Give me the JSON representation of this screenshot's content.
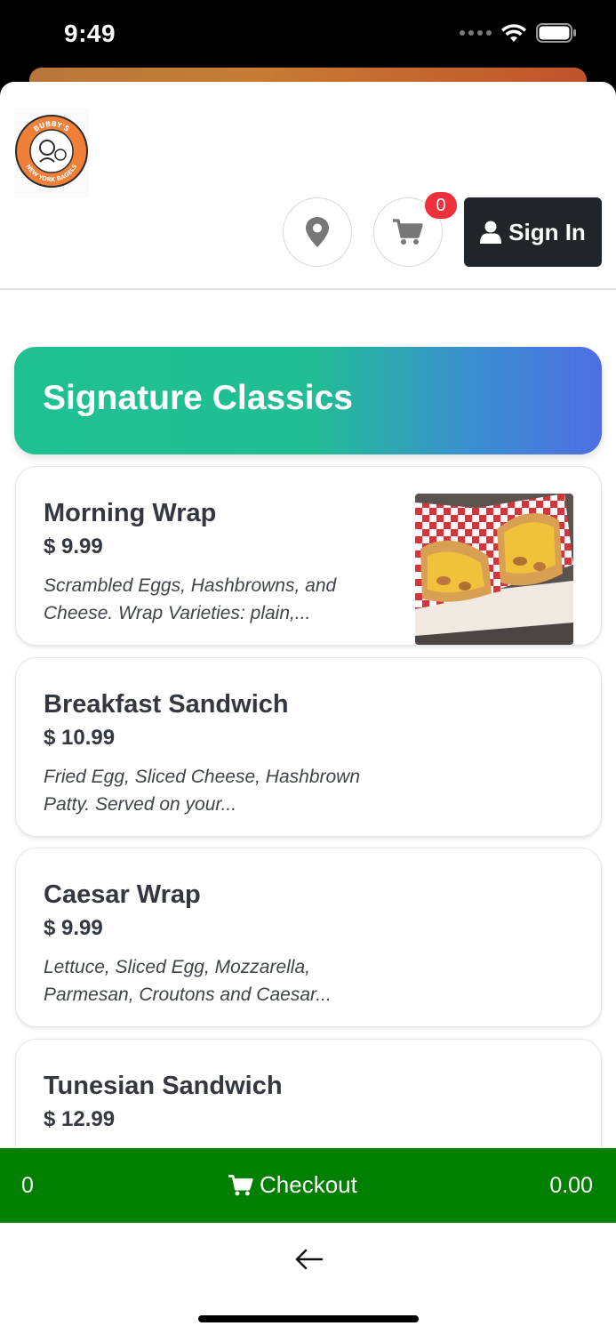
{
  "status_bar": {
    "time": "9:49"
  },
  "header": {
    "logo_top_text": "BUBBY'S",
    "logo_bottom_text": "NEW YORK BAGELS",
    "cart_badge": "0",
    "sign_in_label": "Sign In"
  },
  "category": {
    "title": "Signature Classics"
  },
  "items": [
    {
      "name": "Morning Wrap",
      "price": "$ 9.99",
      "description": "Scrambled Eggs, Hashbrowns, and Cheese. Wrap Varieties: plain,..."
    },
    {
      "name": "Breakfast Sandwich",
      "price": "$ 10.99",
      "description": "Fried Egg, Sliced Cheese, Hashbrown Patty. Served on your..."
    },
    {
      "name": "Caesar Wrap",
      "price": "$ 9.99",
      "description": "Lettuce, Sliced Egg, Mozzarella, Parmesan, Croutons and Caesar..."
    },
    {
      "name": "Tunesian Sandwich",
      "price": "$ 12.99",
      "description": ""
    }
  ],
  "checkout": {
    "count": "0",
    "label": "Checkout",
    "total": "0.00"
  },
  "colors": {
    "checkout_green": "#007f00",
    "category_gradient_start": "#1fc193",
    "category_gradient_end": "#4e6ee3",
    "badge_red": "#f0303a",
    "sign_in_dark": "#212429"
  },
  "icons": [
    "wifi-icon",
    "battery-icon",
    "location-pin-icon",
    "cart-icon",
    "user-icon",
    "back-arrow-icon"
  ]
}
